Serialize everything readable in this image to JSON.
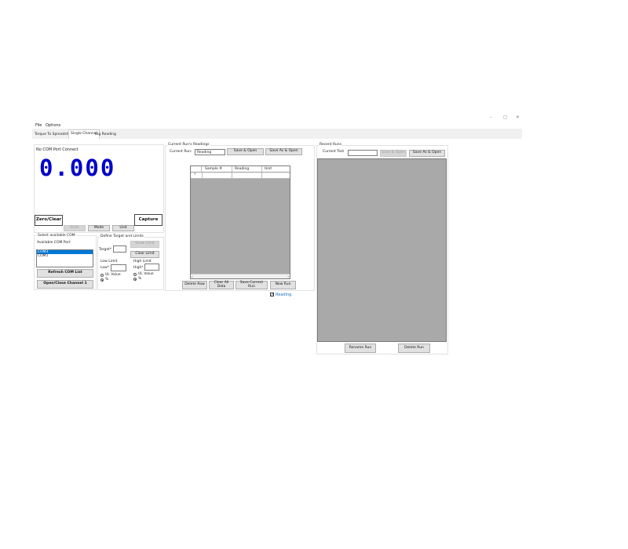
{
  "window": {
    "controls": {
      "minimize": "–",
      "maximize": "▢",
      "close": "✕"
    }
  },
  "menu": {
    "file": "File",
    "options": "Options"
  },
  "tabs": [
    {
      "label": "Torque To Spreadsheet"
    },
    {
      "label": "Single Channel"
    },
    {
      "label": "Big Reading"
    }
  ],
  "display": {
    "status": "No COM Port Connect",
    "value": "0.000",
    "digit_color": "#0000cc",
    "zero_clear": "Zero/Clear",
    "capture": "Capture",
    "units_btn": "Units",
    "mode_btn": "Mode",
    "unit_btn": "Unit"
  },
  "com": {
    "group": "Select available COM",
    "available_label": "Available COM Port",
    "ports": [
      "COM3",
      "COM1"
    ],
    "refresh": "Refresh COM List",
    "open_close": "Open/Close Channel 1"
  },
  "target": {
    "group": "Define Target and Limits",
    "target_label": "Target*",
    "show_limit": "Show Limit",
    "clear_limit": "Clear Limit",
    "low_limit": "Low Limit",
    "low_label": "Low*",
    "high_limit": "High Limit",
    "high_label": "High*",
    "ul_value": "UL Value",
    "percent": "%"
  },
  "current": {
    "group": "Current Run's Readings",
    "run_label": "Current Run:",
    "run_value": "Reading",
    "save_open": "Save & Open",
    "save_as_open": "Save As & Open",
    "columns": [
      "Sample #",
      "Reading",
      "Unit"
    ],
    "row_marker": "*",
    "delete_row": "Delete Row",
    "clear_all": "Clear All Data",
    "save_current": "Save Current Run",
    "new_run": "New Run",
    "reading_check": "Reading",
    "accent": "#1a6fc9"
  },
  "recent": {
    "group": "Recent Runs",
    "test_label": "Current Test",
    "save_open": "Save & Open",
    "save_as_open": "Save As & Open",
    "rename": "Rename Run",
    "delete": "Delete Run"
  }
}
